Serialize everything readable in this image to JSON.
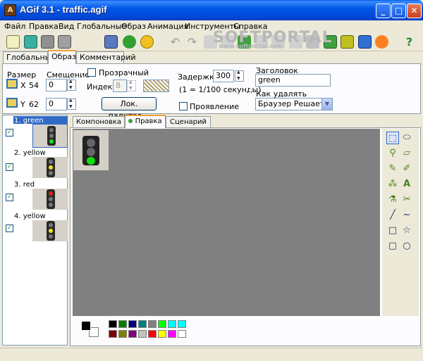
{
  "window": {
    "title": "AGif 3.1 - traffic.agif",
    "app_icon": "picture-icon",
    "minimize": "_",
    "maximize": "□",
    "close": "✕"
  },
  "menu": [
    "Файл",
    "Правка",
    "Вид",
    "Глобальные",
    "Образ",
    "Анимация",
    "Инструменты",
    "Справка"
  ],
  "toolbar": {
    "icons": [
      "new-icon",
      "open-icon",
      "save-icon",
      "save-as-icon",
      "camera-icon",
      "refresh-icon",
      "smile-icon",
      "undo-icon",
      "redo-icon",
      "cut-icon",
      "copy-icon",
      "paste-icon",
      "delete-icon",
      "add-frame-icon",
      "frames-icon",
      "image-icon",
      "export-icon",
      "film-icon",
      "settings-icon",
      "burst-icon",
      "help-icon"
    ],
    "help": "?"
  },
  "watermark": {
    "logo": "SOFTPORTAL",
    "url": "www.softportal.com"
  },
  "tabs": [
    "Глобальные",
    "Образ",
    "Комментарий"
  ],
  "panel": {
    "size_label": "Размер",
    "offset_label": "Смещение",
    "x_label": "X",
    "x_value": "54",
    "y_label": "Y",
    "y_value": "62",
    "offset_x": "0",
    "offset_y": "0",
    "transparent_label": "Прозрачный",
    "index_label": "Индекс",
    "index_value": "8",
    "palette_button": "Лок. палитра...",
    "delay_label": "Задержка",
    "delay_value": "300",
    "delay_unit": "(1 = 1/100 секунды)",
    "interlace_label": "Проявление",
    "caption_label": "Заголовок",
    "caption_value": "green",
    "dispose_label": "Как удалять",
    "dispose_value": "Браузер Решает"
  },
  "frames": [
    {
      "label": "1. green",
      "light": "green",
      "checked": "✓"
    },
    {
      "label": "2. yellow",
      "light": "yellow",
      "checked": "✓"
    },
    {
      "label": "3. red",
      "light": "red",
      "checked": "✓"
    },
    {
      "label": "4. yellow",
      "light": "yellow",
      "checked": "✓"
    }
  ],
  "editor_tabs": [
    "Компоновка",
    "Правка",
    "Сценарий"
  ],
  "tools": [
    "select-rect-icon",
    "lasso-icon",
    "fill-icon",
    "eraser-icon",
    "pencil-icon",
    "brush-icon",
    "spray-icon",
    "text-icon",
    "picker-icon",
    "zoom-icon",
    "line-icon",
    "curve-icon",
    "rectangle-icon",
    "polygon-icon",
    "rounded-rect-icon",
    "ellipse-icon"
  ],
  "tool_glyphs": [
    "⬚",
    "⬭",
    "⚲",
    "▱",
    "✎",
    "✐",
    "⁂",
    "A",
    "⚗",
    "✂",
    "╱",
    "∼",
    "□",
    "☆",
    "▢",
    "○"
  ],
  "palette": {
    "foreground": "#000000",
    "background": "#ffffff",
    "colors_top": [
      "#000000",
      "#008000",
      "#000080",
      "#008080",
      "#808080",
      "#00ff00",
      "#00ffff",
      "#0000ff",
      "#00ffff"
    ],
    "colors_bottom": [
      "#800000",
      "#808000",
      "#800080",
      "#c0c0c0",
      "#ff0000",
      "#ffff00",
      "#ff00ff",
      "#ffffff"
    ]
  }
}
